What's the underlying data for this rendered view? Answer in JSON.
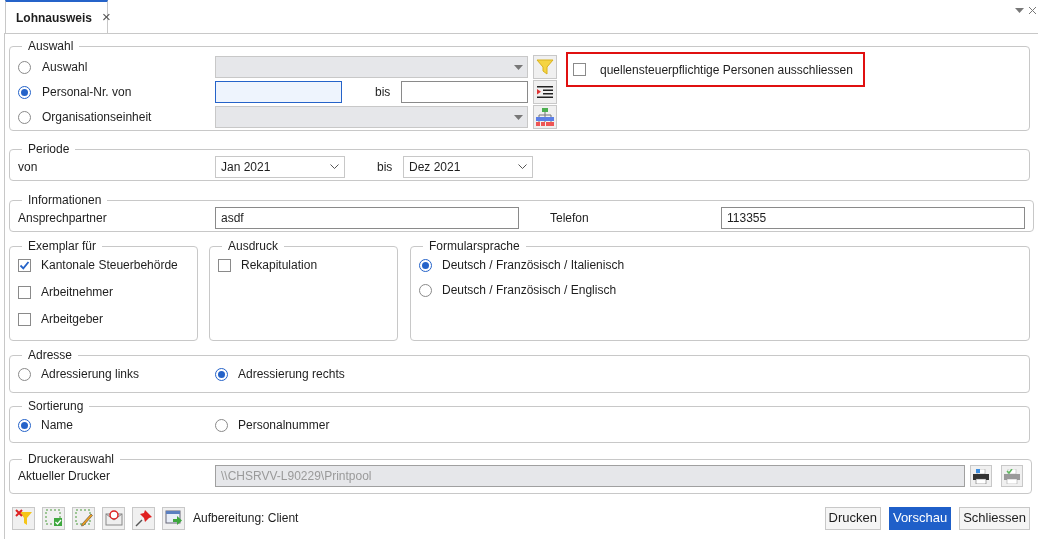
{
  "tabs": [
    {
      "label": "Lohnausweis",
      "selected": true,
      "close": "×"
    }
  ],
  "auswahl": {
    "title": "Auswahl",
    "options": [
      {
        "label": "Auswahl",
        "selected": false,
        "kind": "combo"
      },
      {
        "label": "Personal-Nr. von",
        "selected": true,
        "kind": "range",
        "to_label": "bis"
      },
      {
        "label": "Organisationseinheit",
        "selected": false,
        "kind": "combo"
      }
    ],
    "exclude": {
      "label": "quellensteuerpflichtige Personen ausschliessen",
      "checked": false
    }
  },
  "periode": {
    "title": "Periode",
    "from_label": "von",
    "from": "Jan 2021",
    "to_label": "bis",
    "to": "Dez 2021"
  },
  "informationen": {
    "title": "Informationen",
    "fields": [
      {
        "label": "Ansprechpartner",
        "value": "asdf"
      },
      {
        "label": "Telefon",
        "value": "113355"
      }
    ]
  },
  "exemplar": {
    "title": "Exemplar für",
    "items": [
      {
        "label": "Kantonale Steuerbehörde",
        "checked": true
      },
      {
        "label": "Arbeitnehmer",
        "checked": false
      },
      {
        "label": "Arbeitgeber",
        "checked": false
      }
    ]
  },
  "ausdruck": {
    "title": "Ausdruck",
    "items": [
      {
        "label": "Rekapitulation",
        "checked": false
      }
    ]
  },
  "formularsprache": {
    "title": "Formularsprache",
    "options": [
      {
        "label": "Deutsch / Französisch / Italienisch",
        "selected": true
      },
      {
        "label": "Deutsch / Französisch / Englisch",
        "selected": false
      }
    ]
  },
  "adresse": {
    "title": "Adresse",
    "options": [
      {
        "label": "Adressierung links",
        "selected": false
      },
      {
        "label": "Adressierung rechts",
        "selected": true
      }
    ]
  },
  "sortierung": {
    "title": "Sortierung",
    "options": [
      {
        "label": "Name",
        "selected": true
      },
      {
        "label": "Personalnummer",
        "selected": false
      }
    ]
  },
  "druckerauswahl": {
    "title": "Druckerauswahl",
    "label": "Aktueller Drucker",
    "value": "\\\\CHSRVV-L90229\\Printpool"
  },
  "footer": {
    "status": "Aufbereitung: Client",
    "buttons": [
      {
        "label": "Drucken",
        "selected": false
      },
      {
        "label": "Vorschau",
        "selected": true
      },
      {
        "label": "Schliessen",
        "selected": false
      }
    ]
  }
}
